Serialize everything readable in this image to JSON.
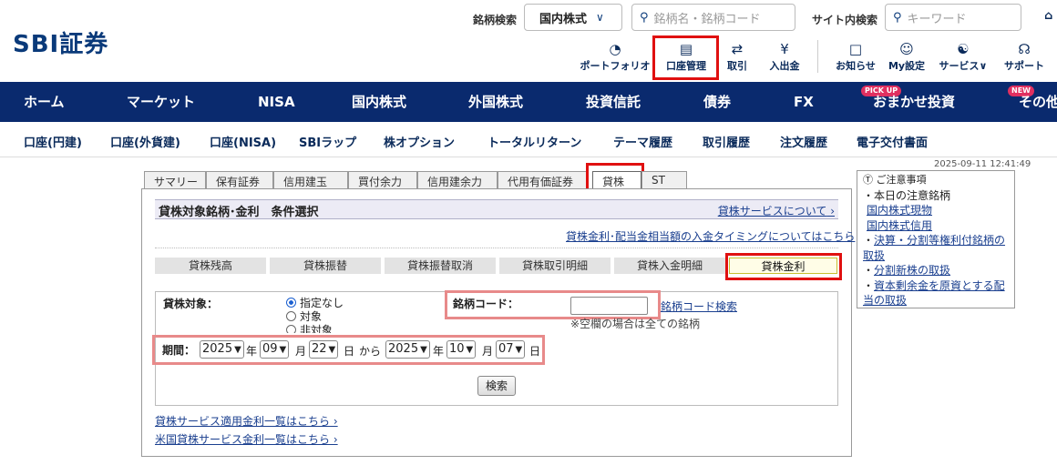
{
  "header": {
    "logo": "SBI証券",
    "stock_search_label": "銘柄検索",
    "market_select": "国内株式",
    "stock_search_placeholder": "銘柄名・銘柄コード",
    "site_search_label": "サイト内検索",
    "site_search_placeholder": "キーワード",
    "icons": [
      {
        "label": "ポートフォリオ",
        "icon": "pie-chart-icon"
      },
      {
        "label": "口座管理",
        "icon": "account-icon"
      },
      {
        "label": "取引",
        "icon": "transfer-icon"
      },
      {
        "label": "入出金",
        "icon": "yen-icon"
      },
      {
        "label": "お知らせ",
        "icon": "speech-icon"
      },
      {
        "label": "My設定",
        "icon": "user-icon"
      },
      {
        "label": "サービス",
        "icon": "service-icon"
      },
      {
        "label": "サポート",
        "icon": "headset-icon"
      }
    ]
  },
  "main_nav": {
    "home": "ホーム",
    "market": "マーケット",
    "nisa": "NISA",
    "domestic": "国内株式",
    "foreign": "外国株式",
    "fund": "投資信託",
    "bond": "債券",
    "fx": "FX",
    "omakase": "おまかせ投資",
    "pickup_badge": "PICK UP",
    "new_badge": "NEW",
    "other": "その他"
  },
  "sub_nav": [
    "口座(円建)",
    "口座(外貨建)",
    "口座(NISA)",
    "SBIラップ",
    "株オプション",
    "トータルリターン",
    "テーマ履歴",
    "取引履歴",
    "注文履歴",
    "電子交付書面"
  ],
  "timestamp": "2025-09-11 12:41:49",
  "tabs": [
    "サマリー",
    "保有証券",
    "信用建玉",
    "買付余力",
    "信用建余力",
    "代用有価証券",
    "貸株",
    "ST"
  ],
  "panel": {
    "title": "貸株対象銘柄･金利　条件選択",
    "service_link": "貸株サービスについて",
    "timing_link": "貸株金利･配当金相当額の入金タイミングについてはこちら",
    "subtabs": [
      "貸株残高",
      "貸株振替",
      "貸株振替取消",
      "貸株取引明細",
      "貸株入金明細",
      "貸株金利"
    ]
  },
  "form": {
    "target_label": "貸株対象：",
    "radio_options": [
      "指定なし",
      "対象",
      "非対象"
    ],
    "code_label": "銘柄コード：",
    "code_value": "",
    "code_search_link": "銘柄コード検索",
    "code_note": "※空欄の場合は全ての銘柄",
    "period_label": "期間：",
    "from_year": "2025",
    "from_month": "09",
    "from_day": "22",
    "to_year": "2025",
    "to_month": "10",
    "to_day": "07",
    "unit_year": "年",
    "unit_month": "月",
    "unit_day": "日",
    "unit_from": "から",
    "search_button": "検索"
  },
  "bottom_links": [
    "貸株サービス適用金利一覧はこちら",
    "米国貸株サービス金利一覧はこちら"
  ],
  "notice": {
    "title": "ご注意事項",
    "items": [
      "・本日の注意銘柄"
    ],
    "links": [
      "国内株式現物",
      "国内株式信用",
      "決算・分割等権利付銘柄の取扱",
      "分割新株の取扱",
      "資本剰余金を原資とする配当の取扱"
    ]
  }
}
